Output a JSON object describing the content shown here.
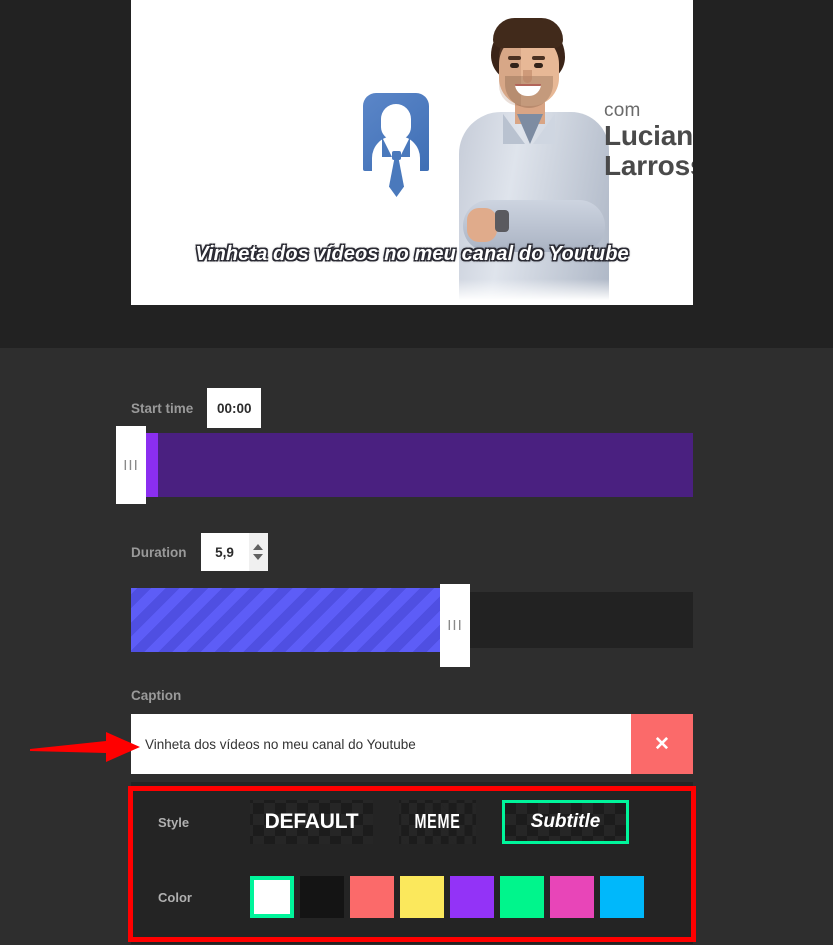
{
  "video_preview": {
    "brand_prefix": "com",
    "brand_line1": "Luciano",
    "brand_line2": "Larrossa",
    "subtitle_overlay": "Vinheta dos vídeos no meu canal do Youtube"
  },
  "controls": {
    "start_time": {
      "label": "Start time",
      "value": "00:00",
      "handle_grip": "III"
    },
    "duration": {
      "label": "Duration",
      "value": "5,9",
      "handle_grip": "III"
    },
    "caption": {
      "label": "Caption",
      "value": "Vinheta dos vídeos no meu canal do Youtube",
      "placeholder": "Caption",
      "delete_label": "✕"
    },
    "style": {
      "label": "Style",
      "options": [
        {
          "label": "DEFAULT",
          "selected": false
        },
        {
          "label": "MEME",
          "selected": false
        },
        {
          "label": "Subtitle",
          "selected": true
        }
      ]
    },
    "color": {
      "label": "Color",
      "selected_index": 0,
      "swatches": [
        {
          "name": "white",
          "hex": "#ffffff",
          "selected": true
        },
        {
          "name": "black",
          "hex": "#141414",
          "selected": false
        },
        {
          "name": "coral-red",
          "hex": "#fb6a6a",
          "selected": false
        },
        {
          "name": "yellow",
          "hex": "#fbe85c",
          "selected": false
        },
        {
          "name": "purple",
          "hex": "#9333f7",
          "selected": false
        },
        {
          "name": "spring-green",
          "hex": "#00f58c",
          "selected": false
        },
        {
          "name": "magenta",
          "hex": "#e845b8",
          "selected": false
        },
        {
          "name": "cyan",
          "hex": "#00b8fb",
          "selected": false
        }
      ]
    }
  },
  "annotations": {
    "highlight_color": "#ff0000",
    "arrow_target": "caption-input",
    "rect_target": "style-color-block"
  },
  "theme": {
    "panel_bg": "#2e2e2e",
    "preview_bg": "#222222",
    "accent_selected": "#00f59b",
    "start_track": "#4a2080",
    "duration_track": "#5d5df7"
  }
}
